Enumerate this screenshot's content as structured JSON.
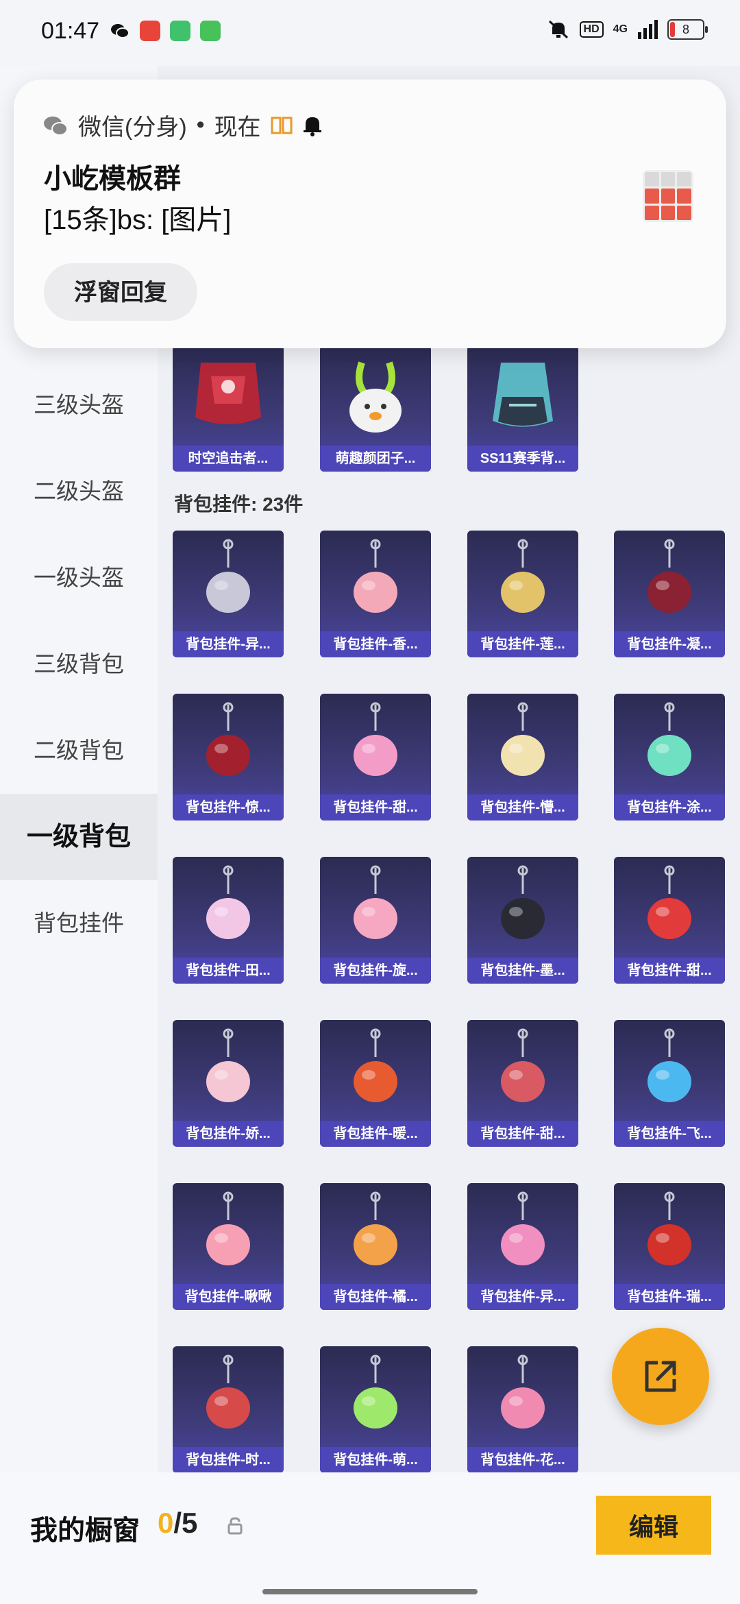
{
  "status_bar": {
    "time": "01:47",
    "network": "4G",
    "battery": "8",
    "hd": "HD"
  },
  "notification": {
    "app": "微信(分身)",
    "dot": "•",
    "when": "现在",
    "title": "小屹模板群",
    "body": "[15条]bs: [图片]",
    "reply_button": "浮窗回复"
  },
  "sidebar": {
    "items": [
      {
        "label": "三级头盔",
        "active": false
      },
      {
        "label": "二级头盔",
        "active": false
      },
      {
        "label": "一级头盔",
        "active": false
      },
      {
        "label": "三级背包",
        "active": false
      },
      {
        "label": "二级背包",
        "active": false
      },
      {
        "label": "一级背包",
        "active": true
      },
      {
        "label": "背包挂件",
        "active": false
      }
    ]
  },
  "top_row": [
    {
      "label": "时空追击者...",
      "icon": "red-backpack-icon"
    },
    {
      "label": "萌趣颜团子...",
      "icon": "bunny-backpack-icon"
    },
    {
      "label": "SS11赛季背...",
      "icon": "teal-backpack-icon"
    }
  ],
  "section": {
    "title": "背包挂件: 23件"
  },
  "charms": [
    {
      "label": "背包挂件-异...",
      "icon": "winged-emblem-icon",
      "color": "#c8c8d8"
    },
    {
      "label": "背包挂件-香...",
      "icon": "pink-flower-icon",
      "color": "#f3a9b8"
    },
    {
      "label": "背包挂件-莲...",
      "icon": "golden-tassel-icon",
      "color": "#e3c36a"
    },
    {
      "label": "背包挂件-凝...",
      "icon": "dark-blade-icon",
      "color": "#8b2233"
    },
    {
      "label": "背包挂件-惊...",
      "icon": "red-tassel-icon",
      "color": "#a3202f"
    },
    {
      "label": "背包挂件-甜...",
      "icon": "candy-cane-bow-icon",
      "color": "#f49cc8"
    },
    {
      "label": "背包挂件-懵...",
      "icon": "feather-charm-icon",
      "color": "#f1e2b0"
    },
    {
      "label": "背包挂件-涂...",
      "icon": "green-swirl-icon",
      "color": "#6fe0c2"
    },
    {
      "label": "背包挂件-田...",
      "icon": "photo-card-icon",
      "color": "#f2c7e6"
    },
    {
      "label": "背包挂件-旋...",
      "icon": "pink-unicorn-icon",
      "color": "#f6a7c1"
    },
    {
      "label": "背包挂件-墨...",
      "icon": "ink-brush-icon",
      "color": "#2a2a35"
    },
    {
      "label": "背包挂件-甜...",
      "icon": "strawberry-icon",
      "color": "#e23b3b"
    },
    {
      "label": "背包挂件-娇...",
      "icon": "pink-pig-bag-icon",
      "color": "#f5c6d3"
    },
    {
      "label": "背包挂件-暖...",
      "icon": "milkshake-icon",
      "color": "#e85a30"
    },
    {
      "label": "背包挂件-甜...",
      "icon": "cat-paw-icon",
      "color": "#d95a63"
    },
    {
      "label": "背包挂件-飞...",
      "icon": "winged-eye-icon",
      "color": "#4cb8f0"
    },
    {
      "label": "背包挂件-啾啾",
      "icon": "pink-bird-icon",
      "color": "#f7a0b4"
    },
    {
      "label": "背包挂件-橘...",
      "icon": "heart-locket-icon",
      "color": "#f3a24a"
    },
    {
      "label": "背包挂件-异...",
      "icon": "roller-skate-icon",
      "color": "#f08fc0"
    },
    {
      "label": "背包挂件-瑞...",
      "icon": "red-key-charm-icon",
      "color": "#d3322b"
    },
    {
      "label": "背包挂件-时...",
      "icon": "crest-emblem-icon",
      "color": "#d64a4a"
    },
    {
      "label": "背包挂件-萌...",
      "icon": "green-slime-icon",
      "color": "#9ee86b"
    },
    {
      "label": "背包挂件-花...",
      "icon": "omamori-icon",
      "color": "#f08ab0"
    }
  ],
  "bottom_bar": {
    "title": "我的橱窗",
    "current": "0",
    "total": "/5",
    "edit_button": "编辑"
  },
  "colors": {
    "accent": "#f5b719",
    "card_label": "#4d46b8"
  }
}
